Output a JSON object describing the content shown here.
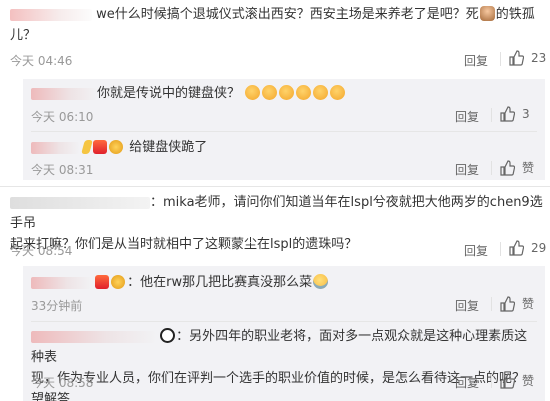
{
  "comments": [
    {
      "text_1": "we什么时候搞个退城仪式滚出西安？西安主场是来养老了是吧？死",
      "text_2": "的铁孤",
      "text_3": "儿？",
      "time": "今天 04:46",
      "reply_label": "回复",
      "like_count": "23"
    },
    {
      "text_1": "mika老师，请问你们知道当年在lspl兮夜就把大他两岁的chen9选手吊",
      "text_2": "起来打嘛？你们是从当时就相中了这颗蒙尘在lspl的遗珠吗？",
      "time": "今天 08:54",
      "reply_label": "回复",
      "like_count": "29"
    }
  ],
  "replies_a": [
    {
      "text": "你就是传说中的键盘侠？",
      "time": "今天 06:10",
      "reply_label": "回复",
      "like_count": "3"
    },
    {
      "text": "给键盘侠跪了",
      "time": "今天 08:31",
      "reply_label": "回复",
      "like_label": "赞"
    }
  ],
  "replies_b": [
    {
      "text": "：他在rw那几把比赛真没那么菜",
      "time": "33分钟前",
      "reply_label": "回复",
      "like_label": "赞"
    },
    {
      "text_1": "：另外四年的职业老将，面对多一点观众就是这种心理素质这种表",
      "text_2": "现，作为专业人员，你们在评判一个选手的职业价值的时候，是怎么看待这一点的呢？望解答",
      "time": "今天 08:58",
      "reply_label": "回复",
      "like_label": "赞"
    }
  ],
  "icons": [
    "thumbs-up-icon",
    "laugh-tears-icon",
    "panda-icon",
    "avatar-emoji-icon"
  ],
  "colors": {
    "text": "#333333",
    "meta": "#999999",
    "subbox": "#f2f2f5"
  }
}
